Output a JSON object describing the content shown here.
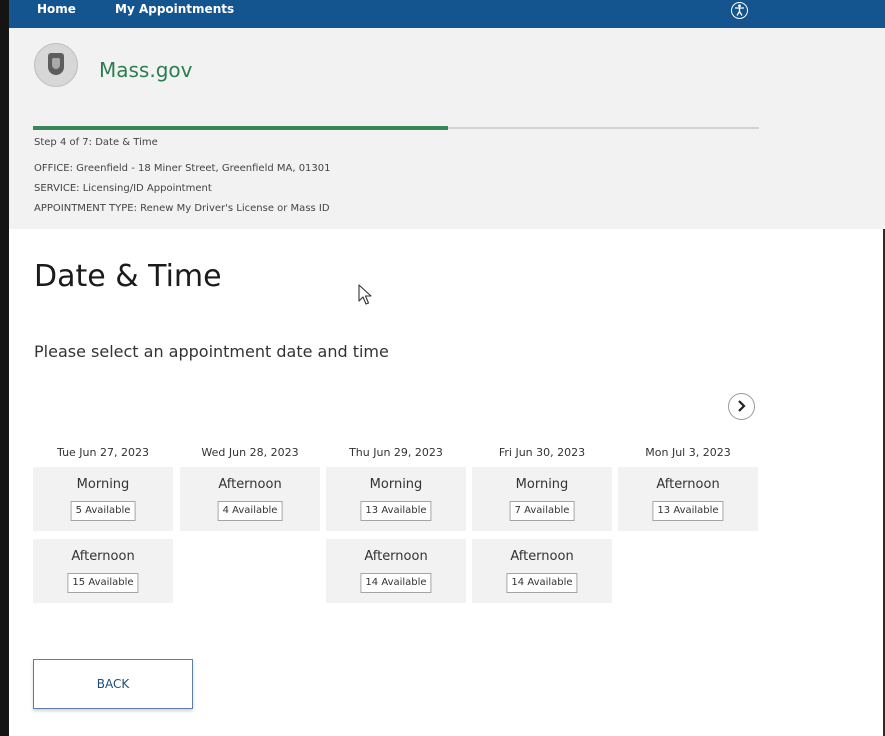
{
  "nav": {
    "home": "Home",
    "appointments": "My Appointments"
  },
  "brand": {
    "name": "Mass.gov"
  },
  "progress": {
    "fraction": 0.571,
    "step_label": "Step 4 of 7: Date & Time"
  },
  "info": {
    "office": "OFFICE: Greenfield - 18 Miner Street, Greenfield MA, 01301",
    "service": "SERVICE: Licensing/ID Appointment",
    "type": "APPOINTMENT TYPE: Renew My Driver's License or Mass ID"
  },
  "main": {
    "title": "Date & Time",
    "instructions": "Please select an appointment date and time"
  },
  "days": [
    {
      "date": "Tue Jun 27, 2023",
      "slots": [
        {
          "period": "Morning",
          "available": "5 Available"
        },
        {
          "period": "Afternoon",
          "available": "15 Available"
        }
      ]
    },
    {
      "date": "Wed Jun 28, 2023",
      "slots": [
        {
          "period": "Afternoon",
          "available": "4 Available"
        }
      ]
    },
    {
      "date": "Thu Jun 29, 2023",
      "slots": [
        {
          "period": "Morning",
          "available": "13 Available"
        },
        {
          "period": "Afternoon",
          "available": "14 Available"
        }
      ]
    },
    {
      "date": "Fri Jun 30, 2023",
      "slots": [
        {
          "period": "Morning",
          "available": "7 Available"
        },
        {
          "period": "Afternoon",
          "available": "14 Available"
        }
      ]
    },
    {
      "date": "Mon Jul 3, 2023",
      "slots": [
        {
          "period": "Afternoon",
          "available": "13 Available"
        }
      ]
    }
  ],
  "buttons": {
    "back": "BACK"
  },
  "icons": {
    "accessibility": "accessibility-icon",
    "next": "chevron-right-icon",
    "seal": "state-seal-icon",
    "cursor": "mouse-cursor-icon"
  },
  "colors": {
    "nav_bg": "#14558f",
    "brand_green": "#2e7d4f",
    "progress_green": "#388557",
    "header_bg": "#f2f2f2"
  }
}
